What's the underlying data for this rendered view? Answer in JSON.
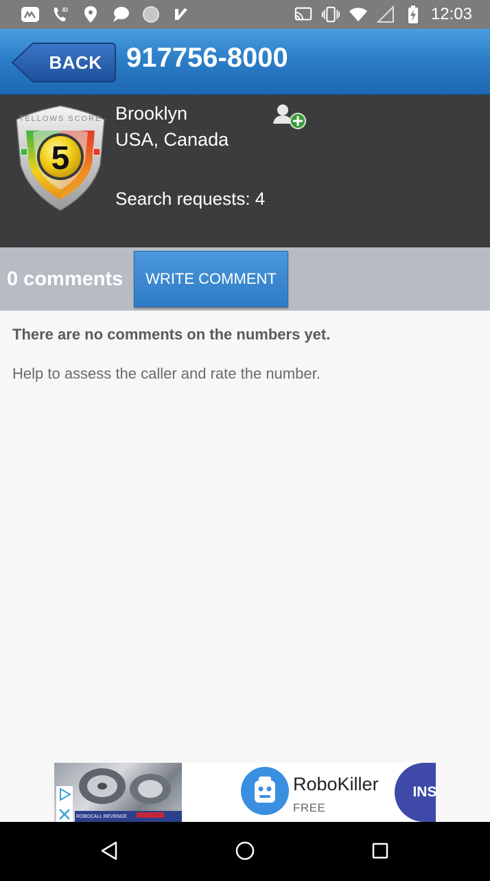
{
  "status_bar": {
    "time": "12:03",
    "left_icons": [
      "app-icon",
      "phone-id-icon",
      "location-pin-icon",
      "chat-bubble-icon",
      "blurred-circle-icon",
      "checkmark-icon"
    ],
    "right_icons": [
      "cast-icon",
      "vibrate-icon",
      "wifi-icon",
      "signal-icon",
      "battery-charging-icon"
    ]
  },
  "header": {
    "back_label": "BACK",
    "phone_number": "917756-8000"
  },
  "info": {
    "score": "5",
    "score_label": "TELLOWS SCORE",
    "city": "Brooklyn",
    "country": "USA, Canada",
    "search_requests": "Search requests: 4"
  },
  "comments": {
    "count_label": "0 comments",
    "write_button": "WRITE COMMENT",
    "empty_title": "There are no comments on the numbers yet.",
    "empty_help": "Help to assess the caller and rate the number."
  },
  "ad": {
    "app_name": "RoboKiller",
    "price": "FREE",
    "install_label": "INSTALL",
    "image_caption": "ROBOCALL REVENGE"
  },
  "colors": {
    "header_blue": "#2d7fc8",
    "panel_dark": "#3b3b3d",
    "comments_bar": "#b7bcc4",
    "install_button": "#3f4aa8"
  }
}
